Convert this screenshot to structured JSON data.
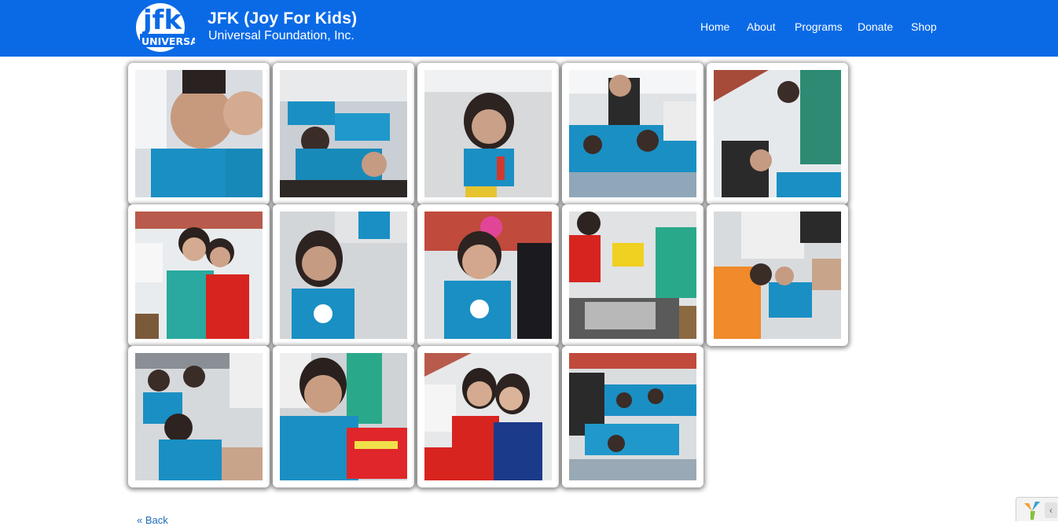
{
  "brand": {
    "logo_text_top": "jfk",
    "logo_text_bottom": "UNIVERSAL",
    "title": "JFK (Joy For Kids)",
    "subtitle": "Universal Foundation, Inc."
  },
  "nav": {
    "items": [
      {
        "label": "Home"
      },
      {
        "label": "About"
      },
      {
        "label": "Programs"
      },
      {
        "label": "Donate"
      },
      {
        "label": "Shop"
      }
    ]
  },
  "gallery": {
    "photos": [
      {
        "name": "photo-two-boys"
      },
      {
        "name": "photo-kids-on-floor"
      },
      {
        "name": "photo-smiling-girl"
      },
      {
        "name": "photo-crowd-of-kids"
      },
      {
        "name": "photo-kids-under-roof"
      },
      {
        "name": "photo-two-women"
      },
      {
        "name": "photo-girl-closeup"
      },
      {
        "name": "photo-toddler-with-bow"
      },
      {
        "name": "photo-group-with-shirts"
      },
      {
        "name": "photo-kids-and-adult"
      },
      {
        "name": "photo-children-group"
      },
      {
        "name": "photo-boy-with-card"
      },
      {
        "name": "photo-two-women-red-blue"
      },
      {
        "name": "photo-crowd-blue-shirts"
      }
    ]
  },
  "footer": {
    "back_label": "« Back"
  },
  "colors": {
    "header_bg": "#0a6ae6",
    "shirt_blue": "#1a8fc4",
    "link": "#1e6bb8"
  },
  "icons": {
    "debug_toolbar": "yii-logo-icon",
    "toggle": "chevron-left-icon"
  }
}
